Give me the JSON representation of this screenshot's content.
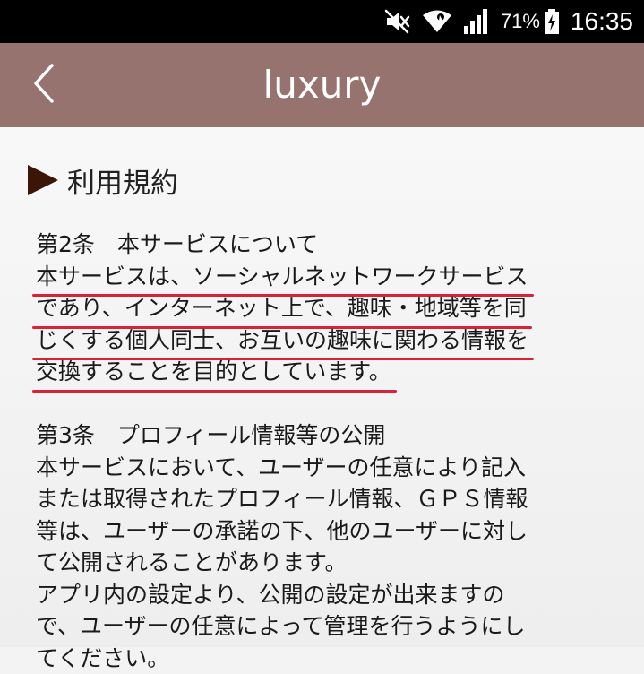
{
  "status_bar": {
    "battery_percent": "71%",
    "time": "16:35",
    "icons": [
      "mute-icon",
      "wifi-icon",
      "signal-icon",
      "battery-charging-icon"
    ]
  },
  "app_bar": {
    "title": "luxury",
    "back_icon": "chevron-left-icon"
  },
  "content": {
    "section_title": "利用規約",
    "articles": [
      {
        "heading": "第2条　本サービスについて",
        "lines": [
          "本サービスは、ソーシャルネットワークサービス",
          "であり、インターネット上で、趣味・地域等を同",
          "じくする個人同士、お互いの趣味に関わる情報を",
          "交換することを目的としています。"
        ],
        "highlighted": true
      },
      {
        "heading": "第3条　プロフィール情報等の公開",
        "lines": [
          "本サービスにおいて、ユーザーの任意により記入",
          "または取得されたプロフィール情報、ＧＰＳ情報",
          "等は、ユーザーの承諾の下、他のユーザーに対し",
          "て公開されることがあります。",
          "アプリ内の設定より、公開の設定が出来ますの",
          "で、ユーザーの任意によって管理を行うようにし",
          "てください。"
        ],
        "highlighted": false
      }
    ]
  },
  "colors": {
    "app_bar": "#977370",
    "marker_triangle": "#3b1606",
    "underline": "#d8223a"
  }
}
